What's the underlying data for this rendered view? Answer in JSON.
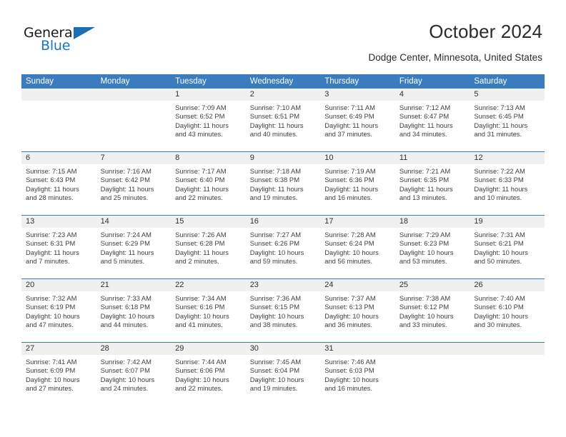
{
  "brand": {
    "name_part1": "General",
    "name_part2": "Blue",
    "triangle_color": "#1a6fb5"
  },
  "header": {
    "title": "October 2024",
    "location": "Dodge Center, Minnesota, United States"
  },
  "theme": {
    "header_blue": "#3a7cbd",
    "daynum_band": "#f0f0f0",
    "text": "#303030"
  },
  "calendar": {
    "weekday_headers": [
      "Sunday",
      "Monday",
      "Tuesday",
      "Wednesday",
      "Thursday",
      "Friday",
      "Saturday"
    ],
    "weeks": [
      [
        {
          "day": "",
          "sunrise": "",
          "sunset": "",
          "daylight": "",
          "daylight2": ""
        },
        {
          "day": "",
          "sunrise": "",
          "sunset": "",
          "daylight": "",
          "daylight2": ""
        },
        {
          "day": "1",
          "sunrise": "Sunrise: 7:09 AM",
          "sunset": "Sunset: 6:52 PM",
          "daylight": "Daylight: 11 hours",
          "daylight2": "and 43 minutes."
        },
        {
          "day": "2",
          "sunrise": "Sunrise: 7:10 AM",
          "sunset": "Sunset: 6:51 PM",
          "daylight": "Daylight: 11 hours",
          "daylight2": "and 40 minutes."
        },
        {
          "day": "3",
          "sunrise": "Sunrise: 7:11 AM",
          "sunset": "Sunset: 6:49 PM",
          "daylight": "Daylight: 11 hours",
          "daylight2": "and 37 minutes."
        },
        {
          "day": "4",
          "sunrise": "Sunrise: 7:12 AM",
          "sunset": "Sunset: 6:47 PM",
          "daylight": "Daylight: 11 hours",
          "daylight2": "and 34 minutes."
        },
        {
          "day": "5",
          "sunrise": "Sunrise: 7:13 AM",
          "sunset": "Sunset: 6:45 PM",
          "daylight": "Daylight: 11 hours",
          "daylight2": "and 31 minutes."
        }
      ],
      [
        {
          "day": "6",
          "sunrise": "Sunrise: 7:15 AM",
          "sunset": "Sunset: 6:43 PM",
          "daylight": "Daylight: 11 hours",
          "daylight2": "and 28 minutes."
        },
        {
          "day": "7",
          "sunrise": "Sunrise: 7:16 AM",
          "sunset": "Sunset: 6:42 PM",
          "daylight": "Daylight: 11 hours",
          "daylight2": "and 25 minutes."
        },
        {
          "day": "8",
          "sunrise": "Sunrise: 7:17 AM",
          "sunset": "Sunset: 6:40 PM",
          "daylight": "Daylight: 11 hours",
          "daylight2": "and 22 minutes."
        },
        {
          "day": "9",
          "sunrise": "Sunrise: 7:18 AM",
          "sunset": "Sunset: 6:38 PM",
          "daylight": "Daylight: 11 hours",
          "daylight2": "and 19 minutes."
        },
        {
          "day": "10",
          "sunrise": "Sunrise: 7:19 AM",
          "sunset": "Sunset: 6:36 PM",
          "daylight": "Daylight: 11 hours",
          "daylight2": "and 16 minutes."
        },
        {
          "day": "11",
          "sunrise": "Sunrise: 7:21 AM",
          "sunset": "Sunset: 6:35 PM",
          "daylight": "Daylight: 11 hours",
          "daylight2": "and 13 minutes."
        },
        {
          "day": "12",
          "sunrise": "Sunrise: 7:22 AM",
          "sunset": "Sunset: 6:33 PM",
          "daylight": "Daylight: 11 hours",
          "daylight2": "and 10 minutes."
        }
      ],
      [
        {
          "day": "13",
          "sunrise": "Sunrise: 7:23 AM",
          "sunset": "Sunset: 6:31 PM",
          "daylight": "Daylight: 11 hours",
          "daylight2": "and 7 minutes."
        },
        {
          "day": "14",
          "sunrise": "Sunrise: 7:24 AM",
          "sunset": "Sunset: 6:29 PM",
          "daylight": "Daylight: 11 hours",
          "daylight2": "and 5 minutes."
        },
        {
          "day": "15",
          "sunrise": "Sunrise: 7:26 AM",
          "sunset": "Sunset: 6:28 PM",
          "daylight": "Daylight: 11 hours",
          "daylight2": "and 2 minutes."
        },
        {
          "day": "16",
          "sunrise": "Sunrise: 7:27 AM",
          "sunset": "Sunset: 6:26 PM",
          "daylight": "Daylight: 10 hours",
          "daylight2": "and 59 minutes."
        },
        {
          "day": "17",
          "sunrise": "Sunrise: 7:28 AM",
          "sunset": "Sunset: 6:24 PM",
          "daylight": "Daylight: 10 hours",
          "daylight2": "and 56 minutes."
        },
        {
          "day": "18",
          "sunrise": "Sunrise: 7:29 AM",
          "sunset": "Sunset: 6:23 PM",
          "daylight": "Daylight: 10 hours",
          "daylight2": "and 53 minutes."
        },
        {
          "day": "19",
          "sunrise": "Sunrise: 7:31 AM",
          "sunset": "Sunset: 6:21 PM",
          "daylight": "Daylight: 10 hours",
          "daylight2": "and 50 minutes."
        }
      ],
      [
        {
          "day": "20",
          "sunrise": "Sunrise: 7:32 AM",
          "sunset": "Sunset: 6:19 PM",
          "daylight": "Daylight: 10 hours",
          "daylight2": "and 47 minutes."
        },
        {
          "day": "21",
          "sunrise": "Sunrise: 7:33 AM",
          "sunset": "Sunset: 6:18 PM",
          "daylight": "Daylight: 10 hours",
          "daylight2": "and 44 minutes."
        },
        {
          "day": "22",
          "sunrise": "Sunrise: 7:34 AM",
          "sunset": "Sunset: 6:16 PM",
          "daylight": "Daylight: 10 hours",
          "daylight2": "and 41 minutes."
        },
        {
          "day": "23",
          "sunrise": "Sunrise: 7:36 AM",
          "sunset": "Sunset: 6:15 PM",
          "daylight": "Daylight: 10 hours",
          "daylight2": "and 38 minutes."
        },
        {
          "day": "24",
          "sunrise": "Sunrise: 7:37 AM",
          "sunset": "Sunset: 6:13 PM",
          "daylight": "Daylight: 10 hours",
          "daylight2": "and 36 minutes."
        },
        {
          "day": "25",
          "sunrise": "Sunrise: 7:38 AM",
          "sunset": "Sunset: 6:12 PM",
          "daylight": "Daylight: 10 hours",
          "daylight2": "and 33 minutes."
        },
        {
          "day": "26",
          "sunrise": "Sunrise: 7:40 AM",
          "sunset": "Sunset: 6:10 PM",
          "daylight": "Daylight: 10 hours",
          "daylight2": "and 30 minutes."
        }
      ],
      [
        {
          "day": "27",
          "sunrise": "Sunrise: 7:41 AM",
          "sunset": "Sunset: 6:09 PM",
          "daylight": "Daylight: 10 hours",
          "daylight2": "and 27 minutes."
        },
        {
          "day": "28",
          "sunrise": "Sunrise: 7:42 AM",
          "sunset": "Sunset: 6:07 PM",
          "daylight": "Daylight: 10 hours",
          "daylight2": "and 24 minutes."
        },
        {
          "day": "29",
          "sunrise": "Sunrise: 7:44 AM",
          "sunset": "Sunset: 6:06 PM",
          "daylight": "Daylight: 10 hours",
          "daylight2": "and 22 minutes."
        },
        {
          "day": "30",
          "sunrise": "Sunrise: 7:45 AM",
          "sunset": "Sunset: 6:04 PM",
          "daylight": "Daylight: 10 hours",
          "daylight2": "and 19 minutes."
        },
        {
          "day": "31",
          "sunrise": "Sunrise: 7:46 AM",
          "sunset": "Sunset: 6:03 PM",
          "daylight": "Daylight: 10 hours",
          "daylight2": "and 16 minutes."
        },
        {
          "day": "",
          "sunrise": "",
          "sunset": "",
          "daylight": "",
          "daylight2": ""
        },
        {
          "day": "",
          "sunrise": "",
          "sunset": "",
          "daylight": "",
          "daylight2": ""
        }
      ]
    ]
  }
}
